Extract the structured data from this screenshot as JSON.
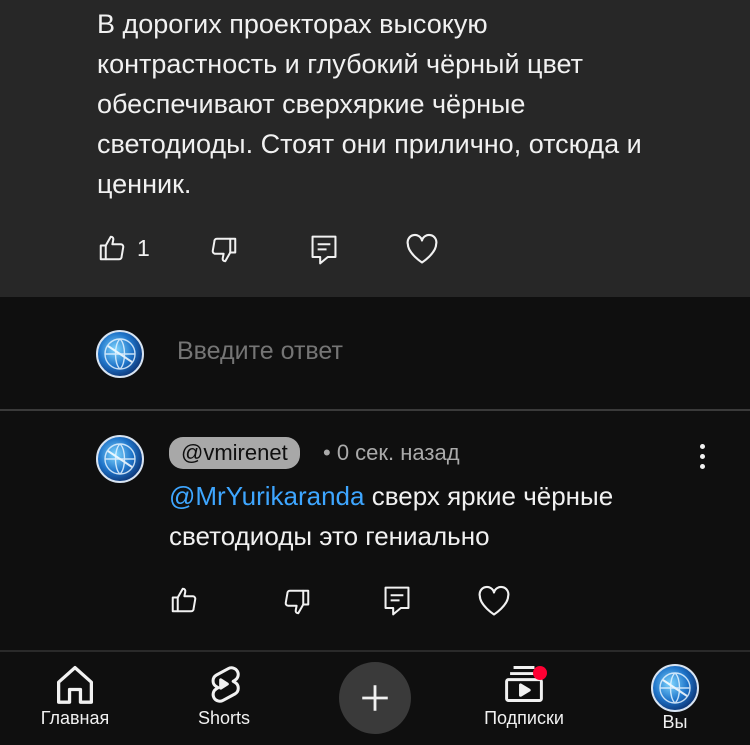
{
  "parent_comment": {
    "text": "В дорогих проекторах высокую\nконтрастность и глубокий чёрный цвет\nобеспечивают сверхяркие чёрные\nсветодиоды. Стоят они прилично, отсюда и\nценник.",
    "like_count": "1"
  },
  "reply_box": {
    "placeholder": "Введите ответ"
  },
  "reply": {
    "author": "@vmirenet",
    "time": "• 0 сек. назад",
    "mention": "@MrYurikaranda",
    "text": " сверх яркие чёрные светодиоды это гениально"
  },
  "nav": {
    "home": "Главная",
    "shorts": "Shorts",
    "subscriptions": "Подписки",
    "you": "Вы"
  },
  "icons": {
    "like": "thumb-up-icon",
    "dislike": "thumb-down-icon",
    "reply": "comment-reply-icon",
    "heart": "heart-icon",
    "more": "more-vertical-icon",
    "home": "home-icon",
    "shorts": "shorts-icon",
    "create": "plus-icon",
    "subscriptions": "subscriptions-icon"
  },
  "colors": {
    "mention": "#3ea6ff",
    "badge": "#ff0033",
    "card_bg": "#272727",
    "bg": "#0f0f0f"
  }
}
